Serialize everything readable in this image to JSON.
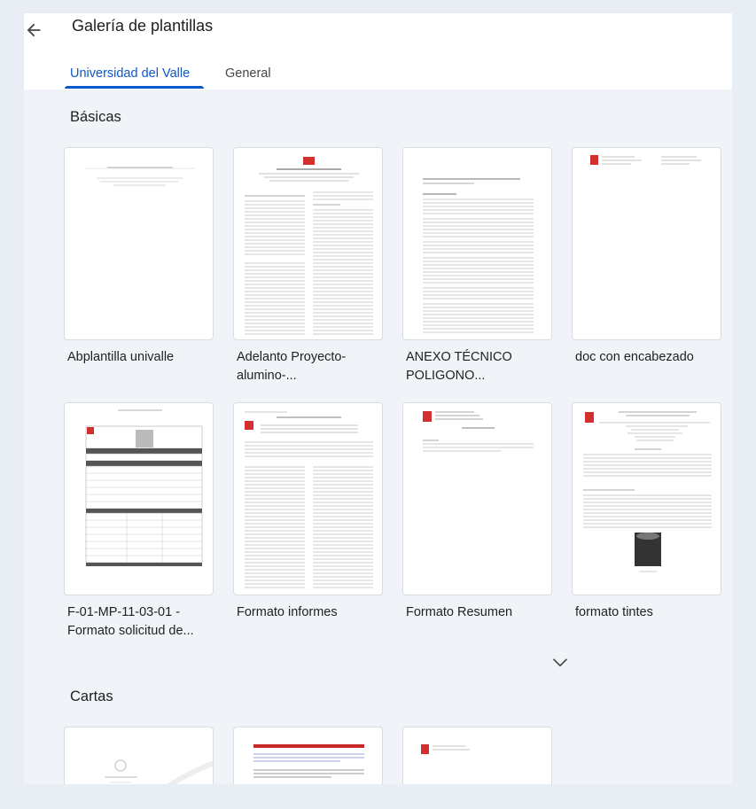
{
  "header": {
    "title": "Galería de plantillas"
  },
  "tabs": [
    {
      "label": "Universidad del Valle",
      "active": true
    },
    {
      "label": "General",
      "active": false
    }
  ],
  "sections": {
    "basicas": "Básicas",
    "cartas": "Cartas"
  },
  "templates": [
    {
      "name": "Abplantilla univalle",
      "line2": "",
      "thumb": "serif-title"
    },
    {
      "name": "Adelanto Proyecto-",
      "line2": "alumino-...",
      "thumb": "two-column-report"
    },
    {
      "name": "ANEXO TÉCNICO",
      "line2": "POLIGONO...",
      "thumb": "dense-text"
    },
    {
      "name": "doc con encabezado",
      "line2": "",
      "thumb": "header-only"
    },
    {
      "name": "F-01-MP-11-03-01 -",
      "line2": "Formato solicitud de...",
      "thumb": "form-table"
    },
    {
      "name": "Formato informes",
      "line2": "",
      "thumb": "two-column-report"
    },
    {
      "name": "Formato Resumen",
      "line2": "",
      "thumb": "resumen"
    },
    {
      "name": "formato tintes",
      "line2": "",
      "thumb": "paper-with-image"
    }
  ],
  "cartas_templates": [
    {
      "thumb": "crest-letter"
    },
    {
      "thumb": "red-banner-letter"
    },
    {
      "thumb": "header-only"
    }
  ],
  "icons": {
    "back": "arrow-left-icon",
    "expand": "chevron-down-icon",
    "logo": "univalle-logo"
  },
  "colors": {
    "accent": "#0b57d0",
    "logo_red": "#d32f2f"
  }
}
